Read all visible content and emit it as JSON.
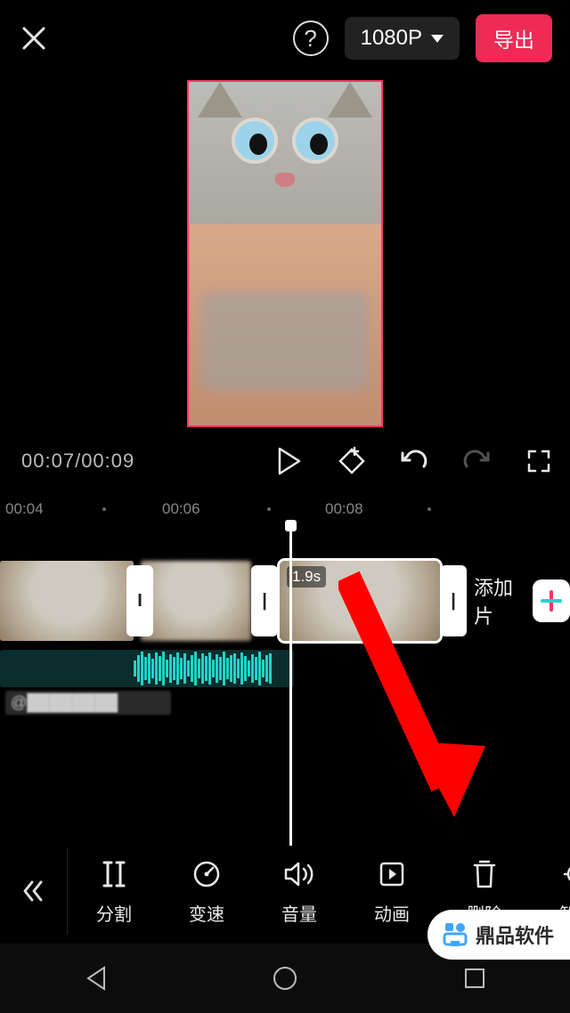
{
  "topbar": {
    "resolution": "1080P",
    "export_label": "导出"
  },
  "playback": {
    "current": "00:07",
    "total": "00:09"
  },
  "ruler": {
    "marks": [
      "00:04",
      "00:06",
      "00:08"
    ]
  },
  "timeline": {
    "selected_clip_duration": "1.9s",
    "add_segment_label": "添加片",
    "audio_author_prefix": "@"
  },
  "toolbar": {
    "items": [
      {
        "id": "split",
        "label": "分割",
        "icon": "split-icon"
      },
      {
        "id": "speed",
        "label": "变速",
        "icon": "speed-icon"
      },
      {
        "id": "volume",
        "label": "音量",
        "icon": "volume-icon"
      },
      {
        "id": "anim",
        "label": "动画",
        "icon": "animation-icon"
      },
      {
        "id": "delete",
        "label": "删除",
        "icon": "delete-icon"
      },
      {
        "id": "smart",
        "label": "智能",
        "icon": "smart-icon"
      }
    ]
  },
  "watermark": {
    "text": "鼎品软件"
  }
}
